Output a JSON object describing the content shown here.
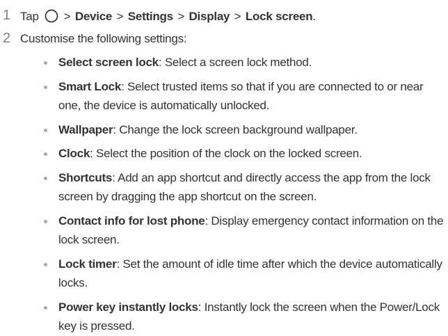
{
  "steps": [
    {
      "number": "1",
      "prefix": "Tap",
      "icon": "home-circle-icon",
      "path": [
        "Device",
        "Settings",
        "Display",
        "Lock screen"
      ],
      "separator": ">",
      "end": "."
    },
    {
      "number": "2",
      "text": "Customise the following settings:"
    }
  ],
  "settings": [
    {
      "title": "Select screen lock",
      "description": ": Select a screen lock method."
    },
    {
      "title": "Smart Lock",
      "description": ": Select trusted items so that if you are connected to or near one, the device is automatically unlocked."
    },
    {
      "title": "Wallpaper",
      "description": ": Change the lock screen background wallpaper."
    },
    {
      "title": "Clock",
      "description": ": Select the position of the clock on the locked screen."
    },
    {
      "title": "Shortcuts",
      "description": ": Add an app shortcut and directly access the app from the lock screen by dragging the app shortcut on the screen."
    },
    {
      "title": "Contact info for lost phone",
      "description": ": Display emergency contact information on the lock screen."
    },
    {
      "title": "Lock timer",
      "description": ": Set the amount of idle time after which the device automatically locks."
    },
    {
      "title": "Power key instantly locks",
      "description": ": Instantly lock the screen when the Power/Lock key is pressed."
    }
  ]
}
